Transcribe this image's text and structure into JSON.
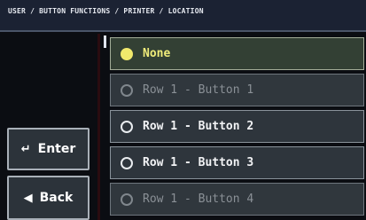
{
  "header": {
    "breadcrumb": "USER / BUTTON FUNCTIONS / PRINTER / LOCATION"
  },
  "side_buttons": {
    "enter": {
      "icon": "↵",
      "label": "Enter"
    },
    "back": {
      "icon": "◀",
      "label": "Back"
    }
  },
  "options": [
    {
      "label": "None",
      "state": "selected"
    },
    {
      "label": "Row 1 - Button 1",
      "state": "disabled"
    },
    {
      "label": "Row 1 - Button 2",
      "state": "enabled"
    },
    {
      "label": "Row 1 - Button 3",
      "state": "enabled"
    },
    {
      "label": "Row 1 - Button 4",
      "state": "disabled"
    }
  ],
  "colors": {
    "selected_text": "#f0ec7a",
    "disabled_text": "#8a9096",
    "header_bg": "#1b2233"
  }
}
